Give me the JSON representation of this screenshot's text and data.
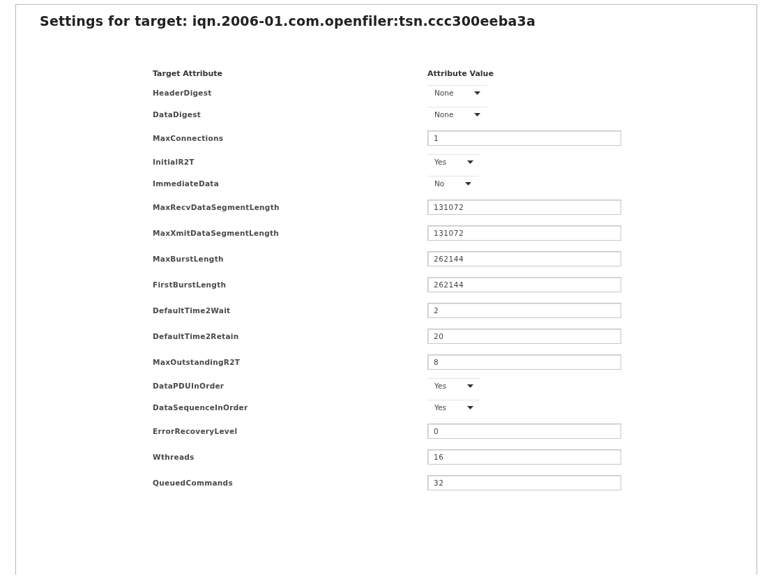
{
  "title": "Settings for target: iqn.2006-01.com.openfiler:tsn.ccc300eeba3a",
  "columns": [
    "Target Attribute",
    "Attribute Value"
  ],
  "rows": [
    {
      "label": "HeaderDigest",
      "kind": "select",
      "value": "None"
    },
    {
      "label": "DataDigest",
      "kind": "select",
      "value": "None"
    },
    {
      "label": "MaxConnections",
      "kind": "text",
      "value": "1"
    },
    {
      "label": "InitialR2T",
      "kind": "select",
      "value": "Yes"
    },
    {
      "label": "ImmediateData",
      "kind": "select",
      "value": "No"
    },
    {
      "label": "MaxRecvDataSegmentLength",
      "kind": "text",
      "value": "131072"
    },
    {
      "label": "MaxXmitDataSegmentLength",
      "kind": "text",
      "value": "131072"
    },
    {
      "label": "MaxBurstLength",
      "kind": "text",
      "value": "262144"
    },
    {
      "label": "FirstBurstLength",
      "kind": "text",
      "value": "262144"
    },
    {
      "label": "DefaultTime2Wait",
      "kind": "text",
      "value": "2"
    },
    {
      "label": "DefaultTime2Retain",
      "kind": "text",
      "value": "20"
    },
    {
      "label": "MaxOutstandingR2T",
      "kind": "text",
      "value": "8"
    },
    {
      "label": "DataPDUInOrder",
      "kind": "select",
      "value": "Yes"
    },
    {
      "label": "DataSequenceInOrder",
      "kind": "select",
      "value": "Yes"
    },
    {
      "label": "ErrorRecoveryLevel",
      "kind": "text",
      "value": "0"
    },
    {
      "label": "Wthreads",
      "kind": "text",
      "value": "16"
    },
    {
      "label": "QueuedCommands",
      "kind": "text",
      "value": "32"
    }
  ]
}
